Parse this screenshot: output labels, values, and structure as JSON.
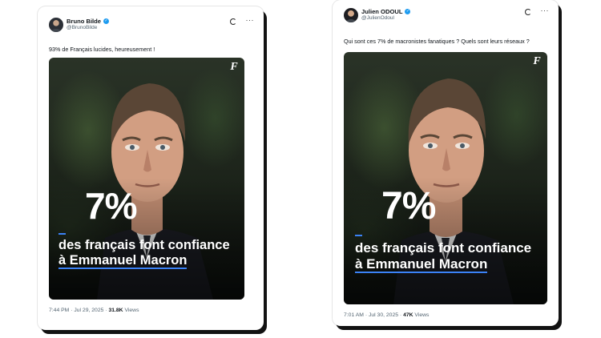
{
  "tweets": [
    {
      "author_name": "Bruno Bilde",
      "handle": "@BrunoBilde",
      "text": "93% de Français lucides, heureusement !",
      "media": {
        "percent": "7%",
        "caption_line1": "des français font confiance",
        "caption_line2": "à Emmanuel Macron"
      },
      "timestamp": "7:44 PM · Jul 29, 2025 · ",
      "views_count": "31.8K",
      "views_label": " Views"
    },
    {
      "author_name": "Julien ODOUL",
      "handle": "@JulienOdoul",
      "text": "Qui sont ces 7% de macronistes fanatiques ? Quels sont leurs réseaux ?",
      "media": {
        "percent": "7%",
        "caption_line1": "des français font confiance",
        "caption_line2": "à Emmanuel Macron"
      },
      "timestamp": "7:01 AM · Jul 30, 2025 · ",
      "views_count": "47K",
      "views_label": " Views"
    }
  ],
  "icons": {
    "verified": "verified-badge-icon",
    "grok": "grok-icon",
    "more": "more-options-icon",
    "brand": "le-figaro-logo"
  },
  "colors": {
    "verified_blue": "#1d9bf0",
    "accent_underline": "#3b82f6"
  }
}
